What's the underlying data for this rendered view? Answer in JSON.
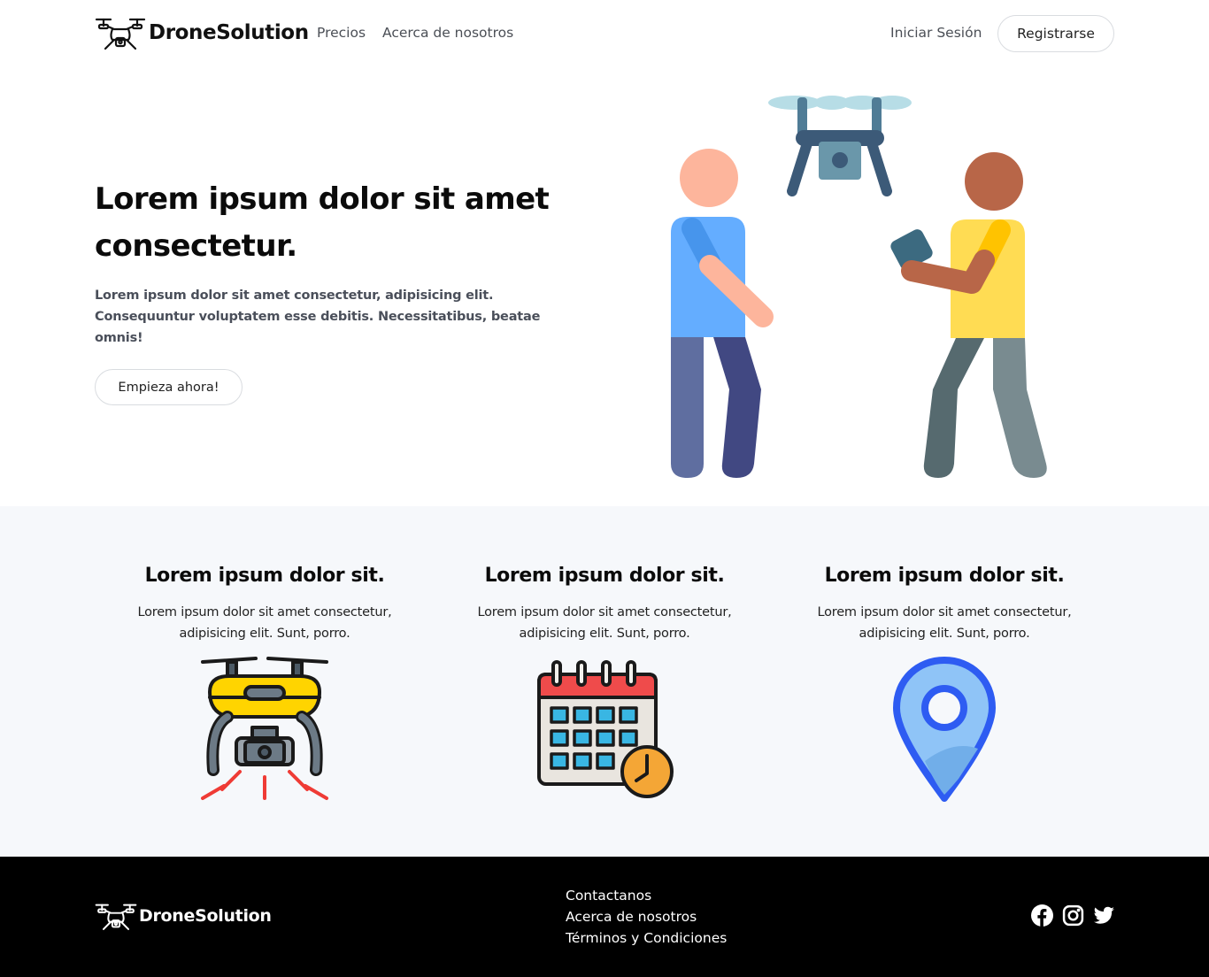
{
  "nav": {
    "brand": "DroneSolution",
    "links": [
      {
        "label": "Precios"
      },
      {
        "label": "Acerca de nosotros"
      }
    ],
    "login_label": "Iniciar Sesión",
    "register_label": "Registrarse"
  },
  "hero": {
    "title": "Lorem ipsum dolor sit amet consectetur.",
    "subtitle": "Lorem ipsum dolor sit amet consectetur, adipisicing elit. Consequuntur voluptatem esse debitis. Necessitatibus, beatae omnis!",
    "cta_label": "Empieza ahora!",
    "illustration": "people-flying-drone"
  },
  "features": [
    {
      "title": "Lorem ipsum dolor sit.",
      "text": "Lorem ipsum dolor sit amet consectetur, adipisicing elit. Sunt, porro.",
      "icon": "drone-camera-icon"
    },
    {
      "title": "Lorem ipsum dolor sit.",
      "text": "Lorem ipsum dolor sit amet consectetur, adipisicing elit. Sunt, porro.",
      "icon": "calendar-clock-icon"
    },
    {
      "title": "Lorem ipsum dolor sit.",
      "text": "Lorem ipsum dolor sit amet consectetur, adipisicing elit. Sunt, porro.",
      "icon": "location-pin-icon"
    }
  ],
  "footer": {
    "brand": "DroneSolution",
    "links": [
      {
        "label": "Contactanos"
      },
      {
        "label": "Acerca de nosotros"
      },
      {
        "label": "Términos y Condiciones"
      }
    ],
    "social": [
      "facebook-icon",
      "instagram-icon",
      "twitter-icon"
    ]
  },
  "colors": {
    "footer_bg": "#000000",
    "features_bg": "#f6f8fb",
    "text_dark": "#0b0b0b",
    "text_muted": "#4a4f5a"
  }
}
